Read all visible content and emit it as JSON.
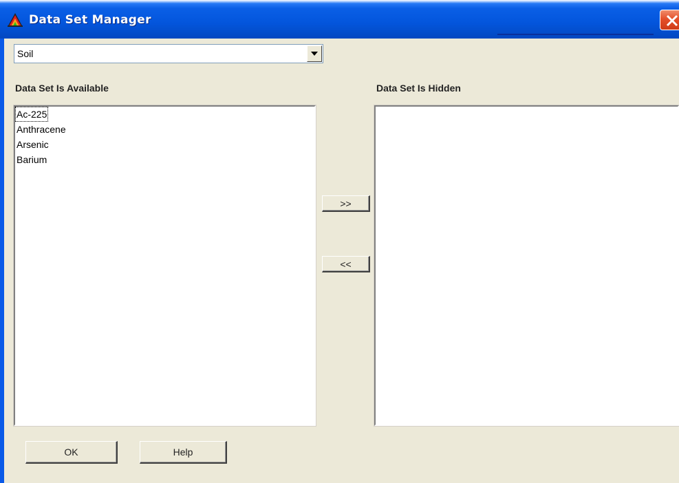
{
  "window": {
    "title": "Data Set Manager"
  },
  "combo": {
    "selected": "Soil"
  },
  "available": {
    "label": "Data Set Is Available",
    "items": [
      "Ac-225",
      "Anthracene",
      "Arsenic",
      "Barium"
    ]
  },
  "hidden": {
    "label": "Data Set Is Hidden",
    "items": []
  },
  "buttons": {
    "move_right": ">>",
    "move_left": "<<",
    "ok": "OK",
    "help": "Help"
  },
  "colors": {
    "titlebar": "#0355dc",
    "close": "#e4502a",
    "dialog_bg": "#ece9d8"
  }
}
